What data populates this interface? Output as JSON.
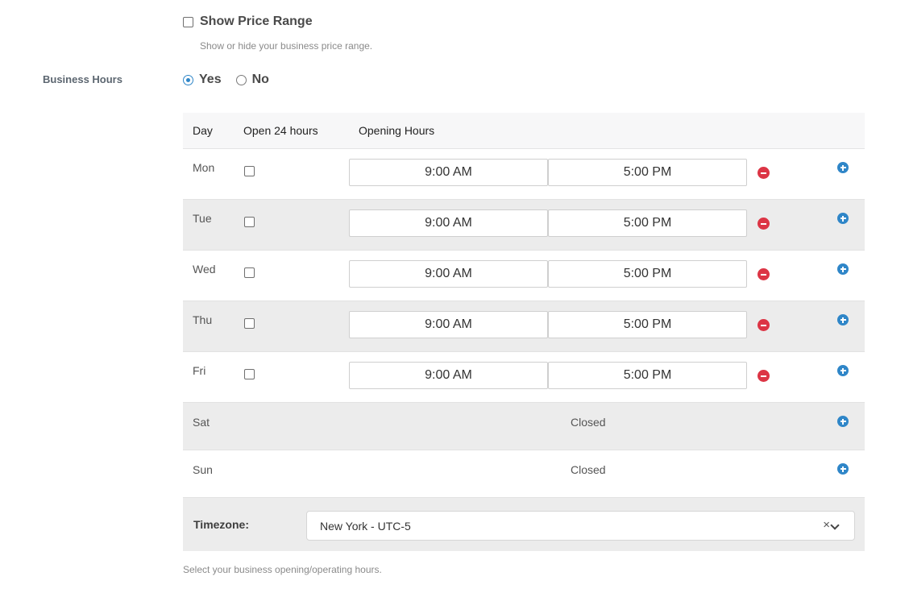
{
  "price_range": {
    "label": "Show Price Range",
    "help": "Show or hide your business price range.",
    "checked": false
  },
  "business_hours": {
    "label": "Business Hours",
    "options": [
      {
        "label": "Yes",
        "selected": true
      },
      {
        "label": "No",
        "selected": false
      }
    ]
  },
  "table": {
    "headers": {
      "day": "Day",
      "open24": "Open 24 hours",
      "hours": "Opening Hours"
    },
    "rows": [
      {
        "day": "Mon",
        "open": "9:00 AM",
        "close": "5:00 PM"
      },
      {
        "day": "Tue",
        "open": "9:00 AM",
        "close": "5:00 PM"
      },
      {
        "day": "Wed",
        "open": "9:00 AM",
        "close": "5:00 PM"
      },
      {
        "day": "Thu",
        "open": "9:00 AM",
        "close": "5:00 PM"
      },
      {
        "day": "Fri",
        "open": "9:00 AM",
        "close": "5:00 PM"
      }
    ],
    "closed_rows": [
      {
        "day": "Sat",
        "status": "Closed"
      },
      {
        "day": "Sun",
        "status": "Closed"
      }
    ]
  },
  "timezone": {
    "label": "Timezone:",
    "value": "New York - UTC-5",
    "clear_glyph": "×"
  },
  "hours_help": "Select your business opening/operating hours.",
  "colors": {
    "accent": "#2f86c8",
    "danger": "#dc3545",
    "row_alt": "#ececec"
  }
}
